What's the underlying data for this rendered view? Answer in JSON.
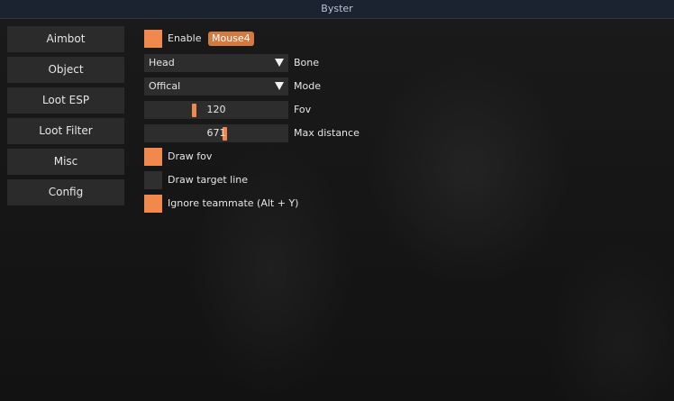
{
  "window": {
    "title": "Byster"
  },
  "sidebar": {
    "items": [
      {
        "label": "Aimbot"
      },
      {
        "label": "Object"
      },
      {
        "label": "Loot ESP"
      },
      {
        "label": "Loot Filter"
      },
      {
        "label": "Misc"
      },
      {
        "label": "Config"
      }
    ]
  },
  "settings": {
    "enable": {
      "label": "Enable",
      "checked": true,
      "key": "Mouse4"
    },
    "bone": {
      "value": "Head",
      "label": "Bone"
    },
    "mode": {
      "value": "Offical",
      "label": "Mode"
    },
    "fov": {
      "value": "120",
      "label": "Fov",
      "fraction": 0.34
    },
    "max_distance": {
      "value": "671",
      "label": "Max distance",
      "fraction": 0.56
    },
    "draw_fov": {
      "label": "Draw fov",
      "checked": true
    },
    "draw_target_line": {
      "label": "Draw target line",
      "checked": false
    },
    "ignore_teammate": {
      "label": "Ignore teammate (Alt + Y)",
      "checked": true
    }
  },
  "colors": {
    "accent": "#f0894b",
    "panel": "#2d2d2d",
    "titlebar": "#1c2330"
  }
}
